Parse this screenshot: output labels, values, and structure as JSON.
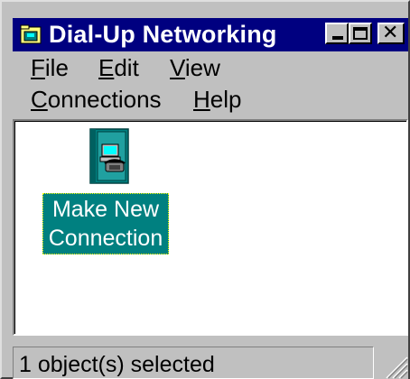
{
  "window": {
    "title": "Dial-Up Networking",
    "title_icon": "dialup-folder-icon"
  },
  "menu": {
    "file": {
      "pre": "",
      "acc": "F",
      "post": "ile"
    },
    "edit": {
      "pre": "",
      "acc": "E",
      "post": "dit"
    },
    "view": {
      "pre": "",
      "acc": "V",
      "post": "iew"
    },
    "connections": {
      "pre": "",
      "acc": "C",
      "post": "onnections"
    },
    "help": {
      "pre": "",
      "acc": "H",
      "post": "elp"
    }
  },
  "content": {
    "items": [
      {
        "label_line1": "Make New",
        "label_line2": "Connection",
        "icon": "make-new-connection-icon",
        "selected": true
      }
    ]
  },
  "status": {
    "text": "1 object(s) selected"
  },
  "colors": {
    "titlebar": "#000080",
    "selection": "#008080",
    "face": "#c0c0c0"
  }
}
